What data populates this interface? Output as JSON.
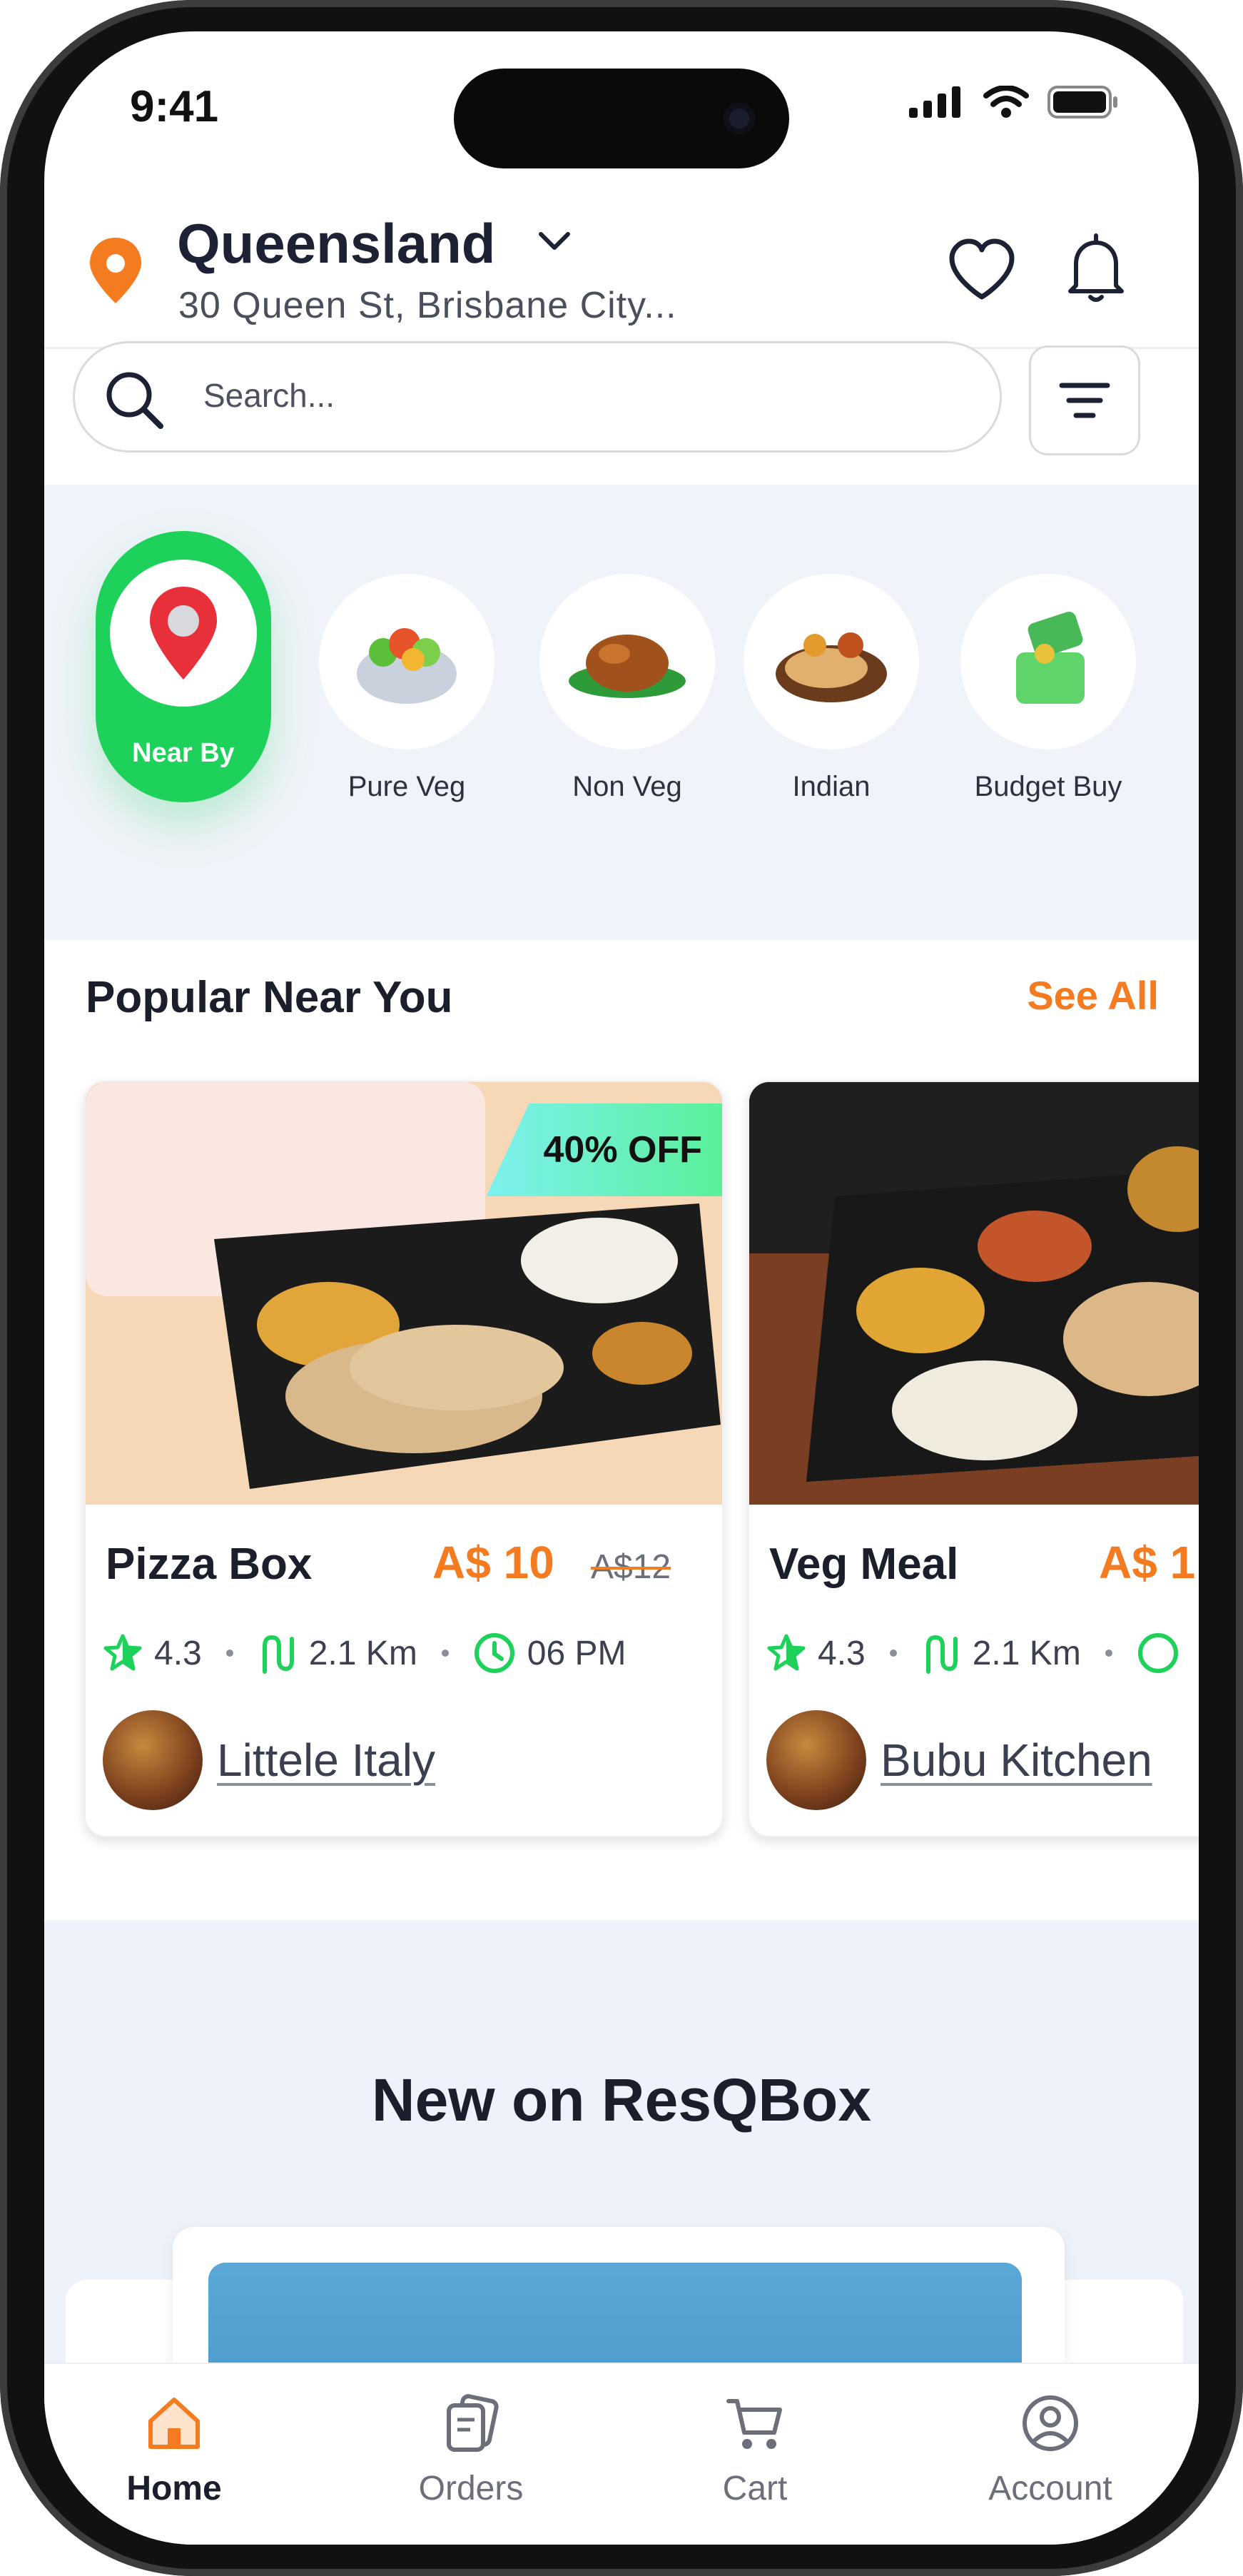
{
  "status_bar": {
    "time": "9:41"
  },
  "header": {
    "city": "Queensland",
    "address": "30 Queen St, Brisbane City..."
  },
  "search": {
    "placeholder": "Search..."
  },
  "categories": [
    {
      "label": "Near By",
      "icon": "location-pin-icon",
      "active": true
    },
    {
      "label": "Pure Veg",
      "icon": "veg-bowl-icon"
    },
    {
      "label": "Non Veg",
      "icon": "roast-chicken-icon"
    },
    {
      "label": "Indian",
      "icon": "indian-food-icon"
    },
    {
      "label": "Budget Buy",
      "icon": "money-box-icon"
    }
  ],
  "popular": {
    "title": "Popular Near You",
    "see_all": "See All",
    "cards": [
      {
        "name": "Pizza Box",
        "price": "A$ 10",
        "old_price": "A$12",
        "badge": "40% OFF",
        "rating": "4.3",
        "distance": "2.1 Km",
        "time": "06 PM",
        "restaurant": "Littele Italy"
      },
      {
        "name": "Veg Meal",
        "price": "A$ 1",
        "rating": "4.3",
        "distance": "2.1 Km",
        "restaurant": "Bubu Kitchen"
      }
    ]
  },
  "new_section": {
    "title": "New on ResQBox"
  },
  "bottom_nav": [
    {
      "label": "Home",
      "icon": "home-icon",
      "active": true
    },
    {
      "label": "Orders",
      "icon": "orders-icon"
    },
    {
      "label": "Cart",
      "icon": "cart-icon"
    },
    {
      "label": "Account",
      "icon": "account-icon"
    }
  ],
  "colors": {
    "accent": "#f47b20",
    "green": "#1ed15a",
    "text": "#1a1f2b"
  }
}
